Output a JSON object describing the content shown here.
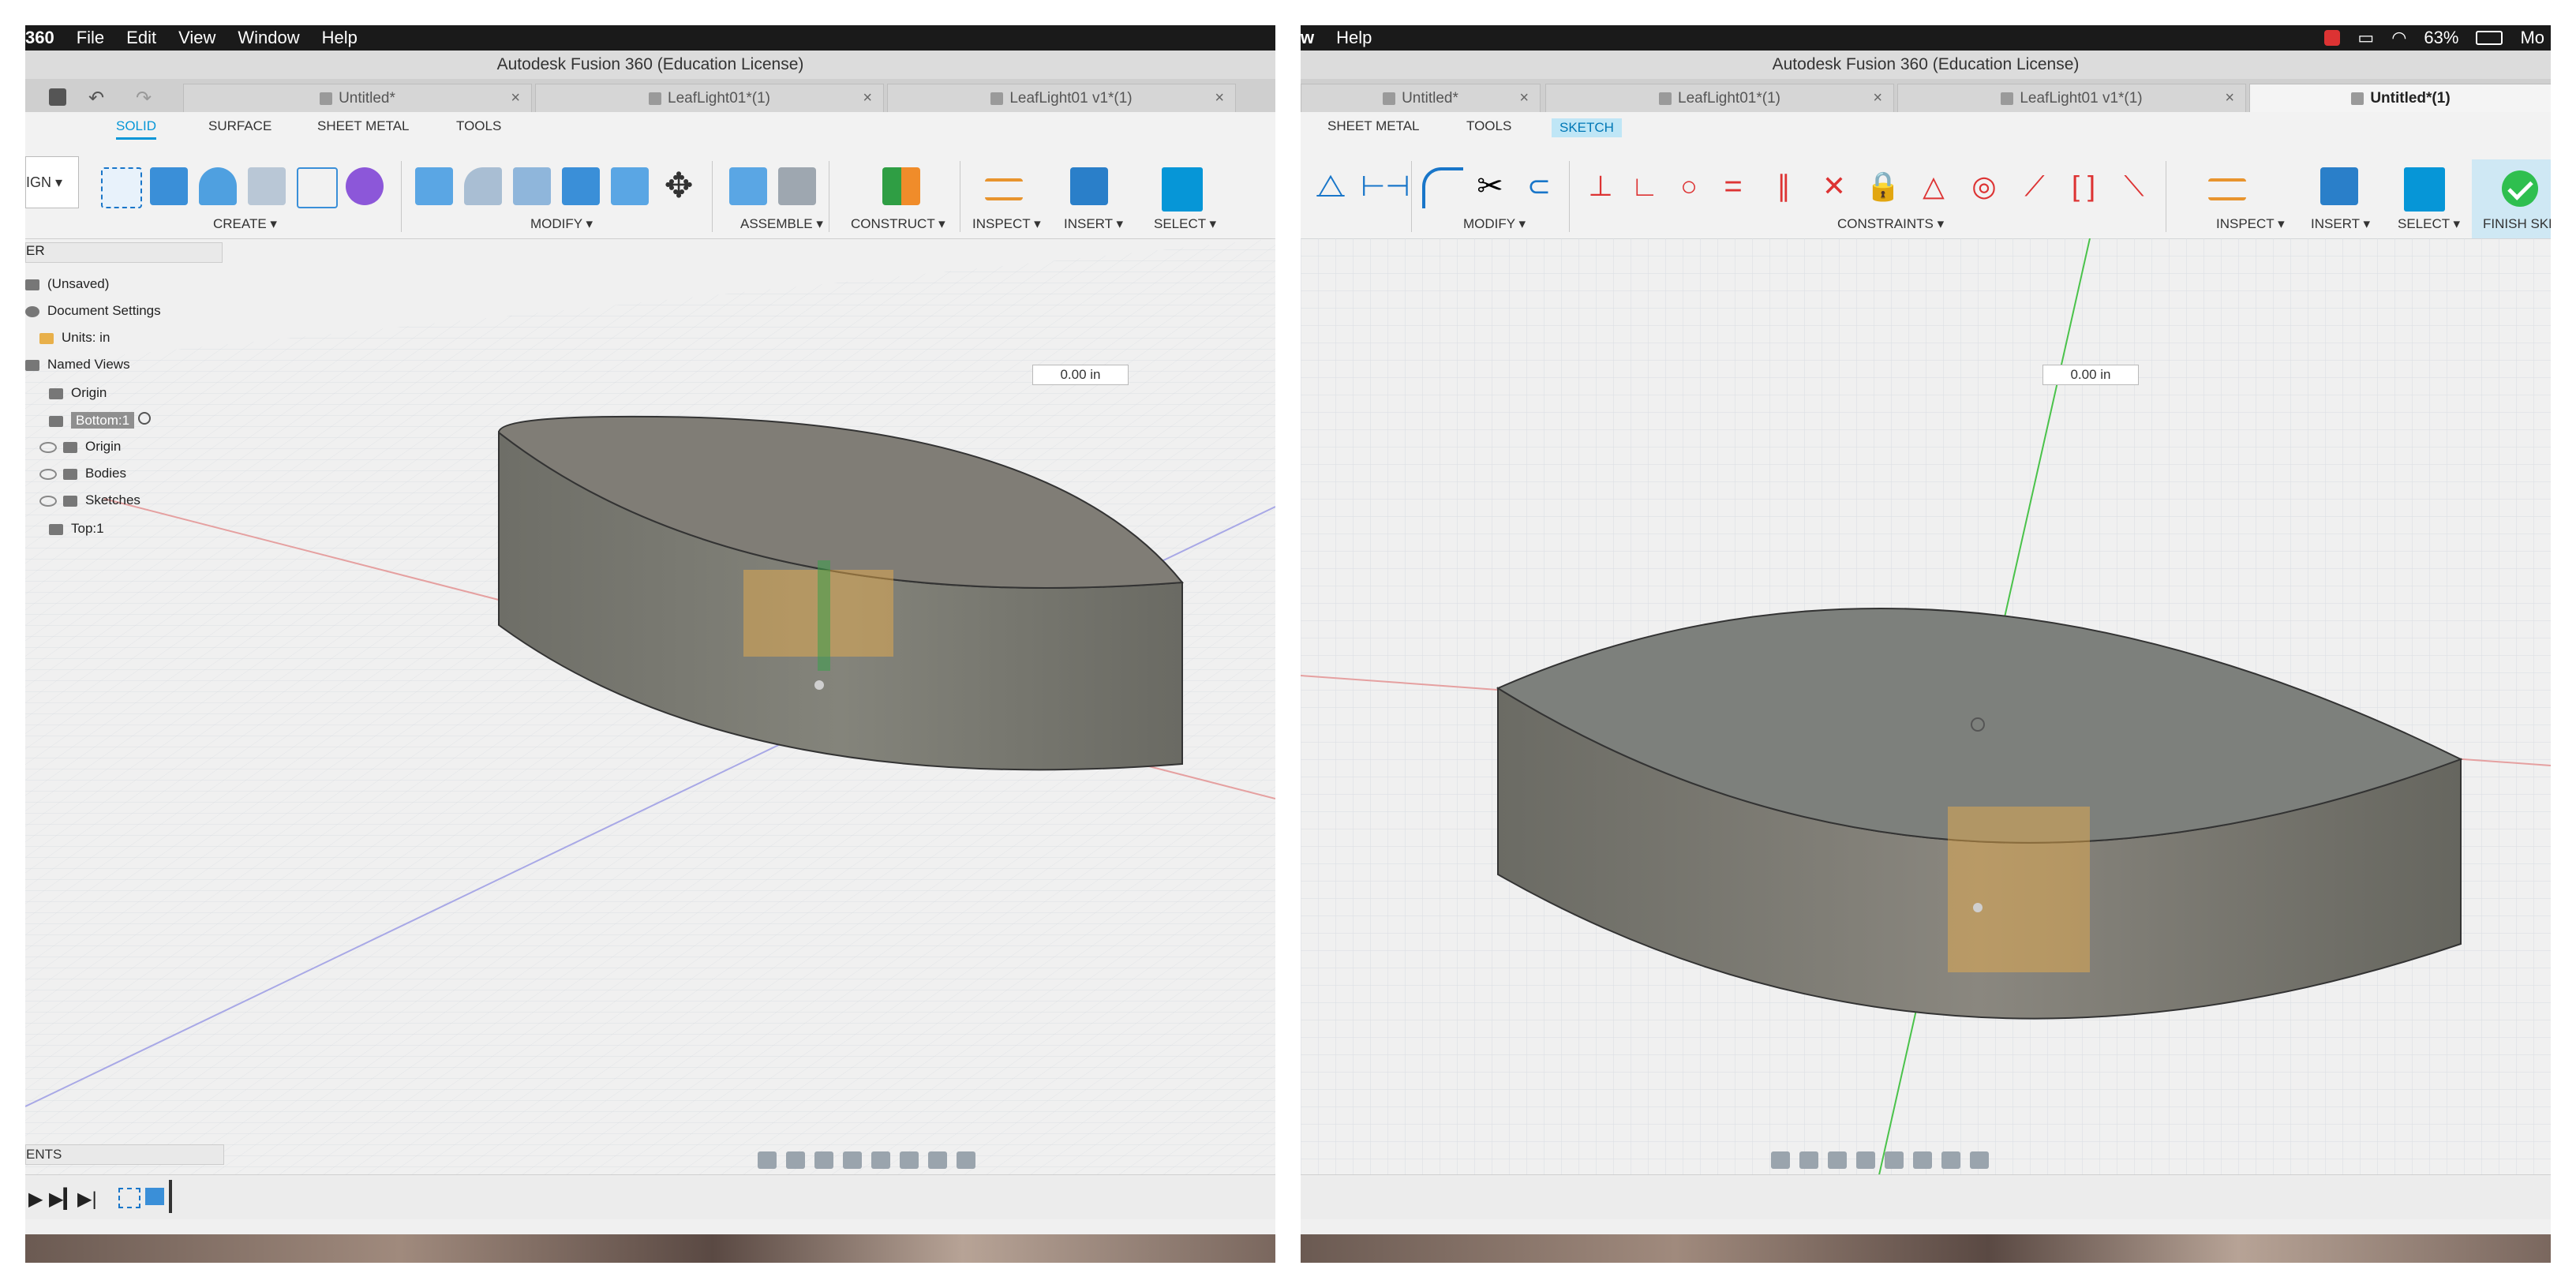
{
  "left": {
    "menubar": {
      "app": "360",
      "items": [
        "File",
        "Edit",
        "View",
        "Window",
        "Help"
      ]
    },
    "window_title": "Autodesk Fusion 360 (Education License)",
    "tabs": [
      "Untitled*",
      "LeafLight01*(1)",
      "LeafLight01 v1*(1)"
    ],
    "workspace_label": "IGN",
    "ribbon_tabs": [
      "SOLID",
      "SURFACE",
      "SHEET METAL",
      "TOOLS"
    ],
    "groups": [
      "CREATE",
      "MODIFY",
      "ASSEMBLE",
      "CONSTRUCT",
      "INSPECT",
      "INSERT",
      "SELECT"
    ],
    "browser": {
      "header": "ER",
      "items": [
        "(Unsaved)",
        "Document Settings",
        "Units: in",
        "Named Views",
        "Origin",
        "Bottom:1",
        "Origin",
        "Bodies",
        "Sketches",
        "Top:1"
      ]
    },
    "dim_value": "0.00 in",
    "comments_label": "ENTS"
  },
  "right": {
    "menubar": {
      "app": "w",
      "items": [
        "Help"
      ],
      "battery": "63%",
      "user": "Mo"
    },
    "window_title": "Autodesk Fusion 360 (Education License)",
    "tabs": [
      "Untitled*",
      "LeafLight01*(1)",
      "LeafLight01 v1*(1)",
      "Untitled*(1)"
    ],
    "ribbon_tabs": [
      "SHEET METAL",
      "TOOLS",
      "SKETCH"
    ],
    "groups": [
      "MODIFY",
      "CONSTRAINTS",
      "INSPECT",
      "INSERT",
      "SELECT"
    ],
    "finish_label": "FINISH SKE",
    "dim_value": "0.00 in"
  },
  "colors": {
    "accent": "#0696d7",
    "body": "#7e7e76",
    "grid": "#d9dde2",
    "menubar": "#1a1a1a",
    "check": "#2fbf4f"
  }
}
